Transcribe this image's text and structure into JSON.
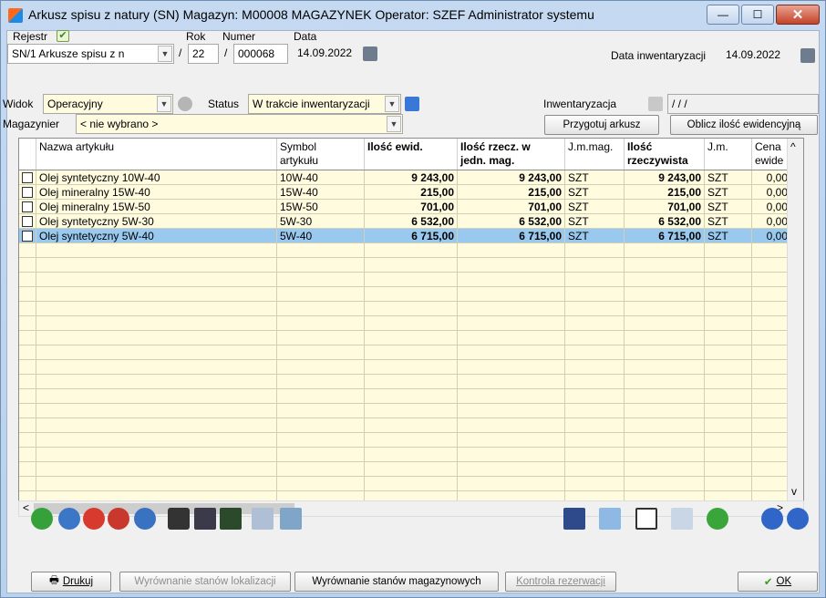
{
  "window": {
    "title": "Arkusz spisu z natury (SN)  Magazyn: M00008 MAGAZYNEK  Operator: SZEF Administrator systemu",
    "close_glyph": "✕",
    "min_glyph": "—",
    "max_glyph": "☐"
  },
  "header": {
    "rejestr_label": "Rejestr",
    "rejestr_value": "SN/1 Arkusze spisu z n",
    "rok_label": "Rok",
    "rok_value": "22",
    "numer_label": "Numer",
    "numer_value": "000068",
    "data_label": "Data",
    "data_value": "14.09.2022",
    "slash1": "/",
    "slash2": "/",
    "data_inw_label": "Data inwentaryzacji",
    "data_inw_value": "14.09.2022",
    "widok_label": "Widok",
    "widok_value": "Operacyjny",
    "status_label": "Status",
    "status_value": "W trakcie inwentaryzacji",
    "inw_label": "Inwentaryzacja",
    "inw_value": "/ / /",
    "magazynier_label": "Magazynier",
    "magazynier_value": "< nie wybrano >",
    "przygotuj_label": "Przygotuj arkusz",
    "oblicz_label": "Oblicz ilość ewidencyjną"
  },
  "table": {
    "columns": [
      {
        "l1": "",
        "l2": ""
      },
      {
        "l1": "Nazwa artykułu",
        "l2": ""
      },
      {
        "l1": "Symbol",
        "l2": "artykułu"
      },
      {
        "l1": "Ilość ewid.",
        "l2": ""
      },
      {
        "l1": "Ilość rzecz. w",
        "l2": "jedn. mag."
      },
      {
        "l1": "J.m.mag.",
        "l2": ""
      },
      {
        "l1": "Ilość",
        "l2": "rzeczywista"
      },
      {
        "l1": "J.m.",
        "l2": ""
      },
      {
        "l1": "Cena",
        "l2": "ewide"
      }
    ],
    "rows": [
      {
        "name": "Olej syntetyczny 10W-40",
        "symbol": "10W-40",
        "ewid": "9 243,00",
        "rzecz_mag": "9 243,00",
        "jm_mag": "SZT",
        "rzecz": "9 243,00",
        "jm": "SZT",
        "cena": "0,00"
      },
      {
        "name": "Olej mineralny 15W-40",
        "symbol": "15W-40",
        "ewid": "215,00",
        "rzecz_mag": "215,00",
        "jm_mag": "SZT",
        "rzecz": "215,00",
        "jm": "SZT",
        "cena": "0,00"
      },
      {
        "name": "Olej mineralny 15W-50",
        "symbol": "15W-50",
        "ewid": "701,00",
        "rzecz_mag": "701,00",
        "jm_mag": "SZT",
        "rzecz": "701,00",
        "jm": "SZT",
        "cena": "0,00"
      },
      {
        "name": "Olej syntetyczny 5W-30",
        "symbol": "5W-30",
        "ewid": "6 532,00",
        "rzecz_mag": "6 532,00",
        "jm_mag": "SZT",
        "rzecz": "6 532,00",
        "jm": "SZT",
        "cena": "0,00"
      },
      {
        "name": "Olej syntetyczny 5W-40",
        "symbol": "5W-40",
        "ewid": "6 715,00",
        "rzecz_mag": "6 715,00",
        "jm_mag": "SZT",
        "rzecz": "6 715,00",
        "jm": "SZT",
        "cena": "0,00"
      }
    ],
    "selected_row": 4,
    "empty_rows": 19
  },
  "scroll": {
    "left": "<",
    "right": ">",
    "up": "^",
    "down": "v"
  },
  "footer": {
    "drukuj": "Drukuj",
    "wyr_lok": "Wyrównanie stanów lokalizacji",
    "wyr_mag": "Wyrównanie stanów magazynowych",
    "kontrola": "Kontrola rezerwacji",
    "ok": "OK"
  },
  "colors": {
    "field_yellow": "#fffbdf",
    "selection": "#99c9ef",
    "titlebar": "#c5d9f1"
  }
}
